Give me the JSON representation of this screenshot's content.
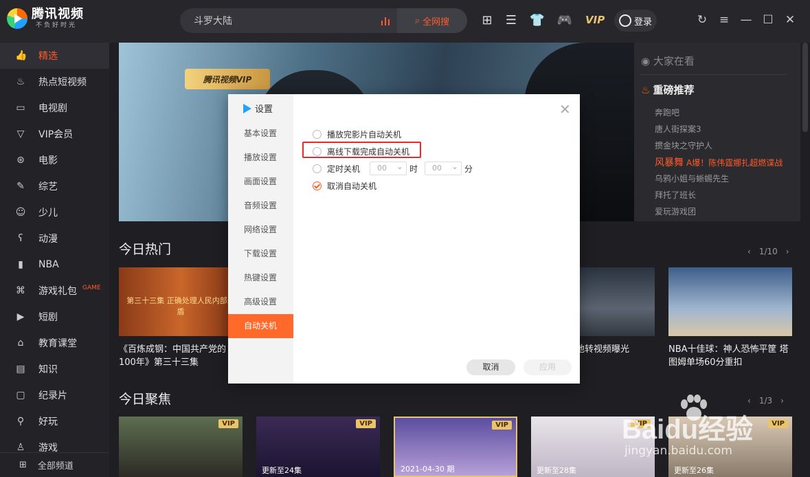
{
  "app": {
    "logo_title": "腾讯视频",
    "logo_slogan": "不负好时光"
  },
  "search": {
    "value": "斗罗大陆",
    "button": "全网搜"
  },
  "header": {
    "vip": "VIP",
    "login": "登录"
  },
  "sidebar": {
    "items": [
      {
        "label": "精选",
        "icon": "thumb-up-icon",
        "active": true
      },
      {
        "label": "热点短视频",
        "icon": "flame-icon"
      },
      {
        "label": "电视剧",
        "icon": "tv-icon"
      },
      {
        "label": "VIP会员",
        "icon": "vip-icon"
      },
      {
        "label": "电影",
        "icon": "film-reel-icon"
      },
      {
        "label": "综艺",
        "icon": "mic-icon"
      },
      {
        "label": "少儿",
        "icon": "kid-icon"
      },
      {
        "label": "动漫",
        "icon": "bear-icon"
      },
      {
        "label": "NBA",
        "icon": "nba-icon"
      },
      {
        "label": "游戏礼包",
        "icon": "gamepad-icon",
        "tag": "GAME"
      },
      {
        "label": "短剧",
        "icon": "play-square-icon"
      },
      {
        "label": "教育课堂",
        "icon": "graduation-icon"
      },
      {
        "label": "知识",
        "icon": "book-icon"
      },
      {
        "label": "纪录片",
        "icon": "camera-icon"
      },
      {
        "label": "好玩",
        "icon": "pin-icon"
      },
      {
        "label": "游戏",
        "icon": "joystick-icon"
      }
    ],
    "all_channels": "全部频道"
  },
  "banner": {
    "badge": "腾讯视频VIP"
  },
  "watching": {
    "title": "大家在看",
    "rec_title": "重磅推荐",
    "items": [
      {
        "text": "奔跑吧"
      },
      {
        "text": "唐人街探案3"
      },
      {
        "text": "掼金块之守护人"
      },
      {
        "text": "风暴舞",
        "sub": "A爆！陈伟霆娜扎超燃谍战",
        "highlight": true
      },
      {
        "text": "乌鸦小姐与蜥蜴先生"
      },
      {
        "text": "拜托了班长"
      },
      {
        "text": "爱玩游戏团"
      }
    ]
  },
  "hot": {
    "title": "今日热门",
    "pager": "1/10",
    "cards": [
      {
        "caption": "《百炼成钢：中国共产党的100年》第三十三集",
        "thumb_text": "第三十三集 正确处理人民内部矛盾"
      },
      {
        "caption": "强风吹得原地转视频曝光"
      },
      {
        "caption": "NBA十佳球：神人恐怖平筐 塔图姆单场60分重扣"
      }
    ]
  },
  "focus": {
    "title": "今日聚焦",
    "pager": "1/3",
    "cards": [
      {
        "badge": "VIP",
        "caption": ""
      },
      {
        "badge": "VIP",
        "caption": "更新至24集"
      },
      {
        "badge": "VIP",
        "caption": "2021-04-30 期"
      },
      {
        "badge": "VIP",
        "caption": "更新至28集"
      },
      {
        "badge": "VIP",
        "caption": "更新至26集"
      }
    ]
  },
  "dialog": {
    "title": "设置",
    "nav": [
      "基本设置",
      "播放设置",
      "画面设置",
      "音频设置",
      "网络设置",
      "下载设置",
      "热键设置",
      "高级设置",
      "自动关机"
    ],
    "active_nav": "自动关机",
    "options": [
      {
        "label": "播放完影片自动关机",
        "checked": false
      },
      {
        "label": "离线下载完成自动关机",
        "checked": false
      },
      {
        "label": "定时关机",
        "checked": false
      },
      {
        "label": "取消自动关机",
        "checked": true
      }
    ],
    "timer": {
      "hour": "00",
      "hour_unit": "时",
      "minute": "00",
      "minute_unit": "分"
    },
    "cancel": "取消",
    "apply": "应用"
  },
  "watermark": {
    "brand": "Baidu经验",
    "url": "jingyan.baidu.com"
  }
}
